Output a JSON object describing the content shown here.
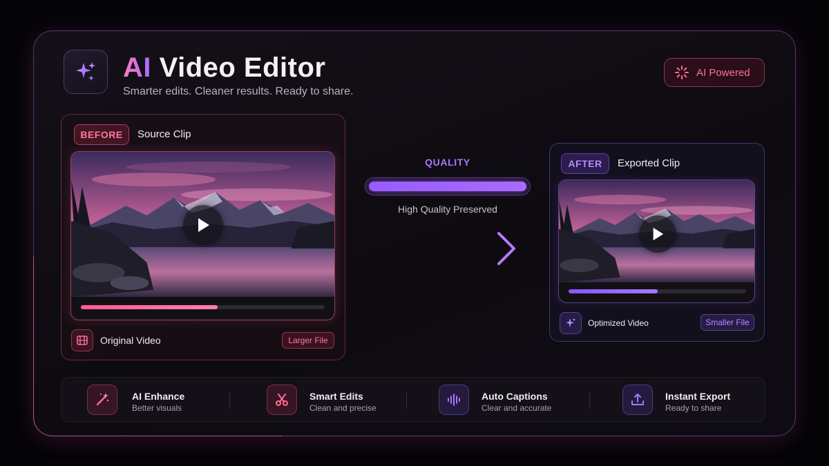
{
  "header": {
    "title_accent": "AI",
    "title_rest": "Video Editor",
    "subtitle": "Smarter edits. Cleaner results. Ready to share.",
    "app_icon": "sparkles-icon",
    "badge": {
      "label": "AI Powered",
      "icon": "burst-icon"
    }
  },
  "before": {
    "chip": "BEFORE",
    "label": "Source Clip",
    "progress": 0.56,
    "footer_icon": "film-icon",
    "footer_label": "Original Video",
    "tag": "Larger File"
  },
  "quality": {
    "label": "QUALITY",
    "level": 1.0,
    "text": "High Quality Preserved"
  },
  "after": {
    "chip": "AFTER",
    "label": "Exported Clip",
    "progress": 0.5,
    "footer_icon": "sparkle-icon",
    "footer_label": "Optimized Video",
    "tag": "Smaller File"
  },
  "features": [
    {
      "title": "AI Enhance",
      "subtitle": "Better visuals",
      "icon": "magic-wand-icon"
    },
    {
      "title": "Smart Edits",
      "subtitle": "Clean and precise",
      "icon": "scissors-icon"
    },
    {
      "title": "Auto Captions",
      "subtitle": "Clear and accurate",
      "icon": "waveform-icon"
    },
    {
      "title": "Instant Export",
      "subtitle": "Ready to share",
      "icon": "upload-icon"
    }
  ],
  "colors": {
    "pink_accent": "#ff6f93",
    "purple_accent": "#a877ff",
    "background": "#0d0b10"
  }
}
